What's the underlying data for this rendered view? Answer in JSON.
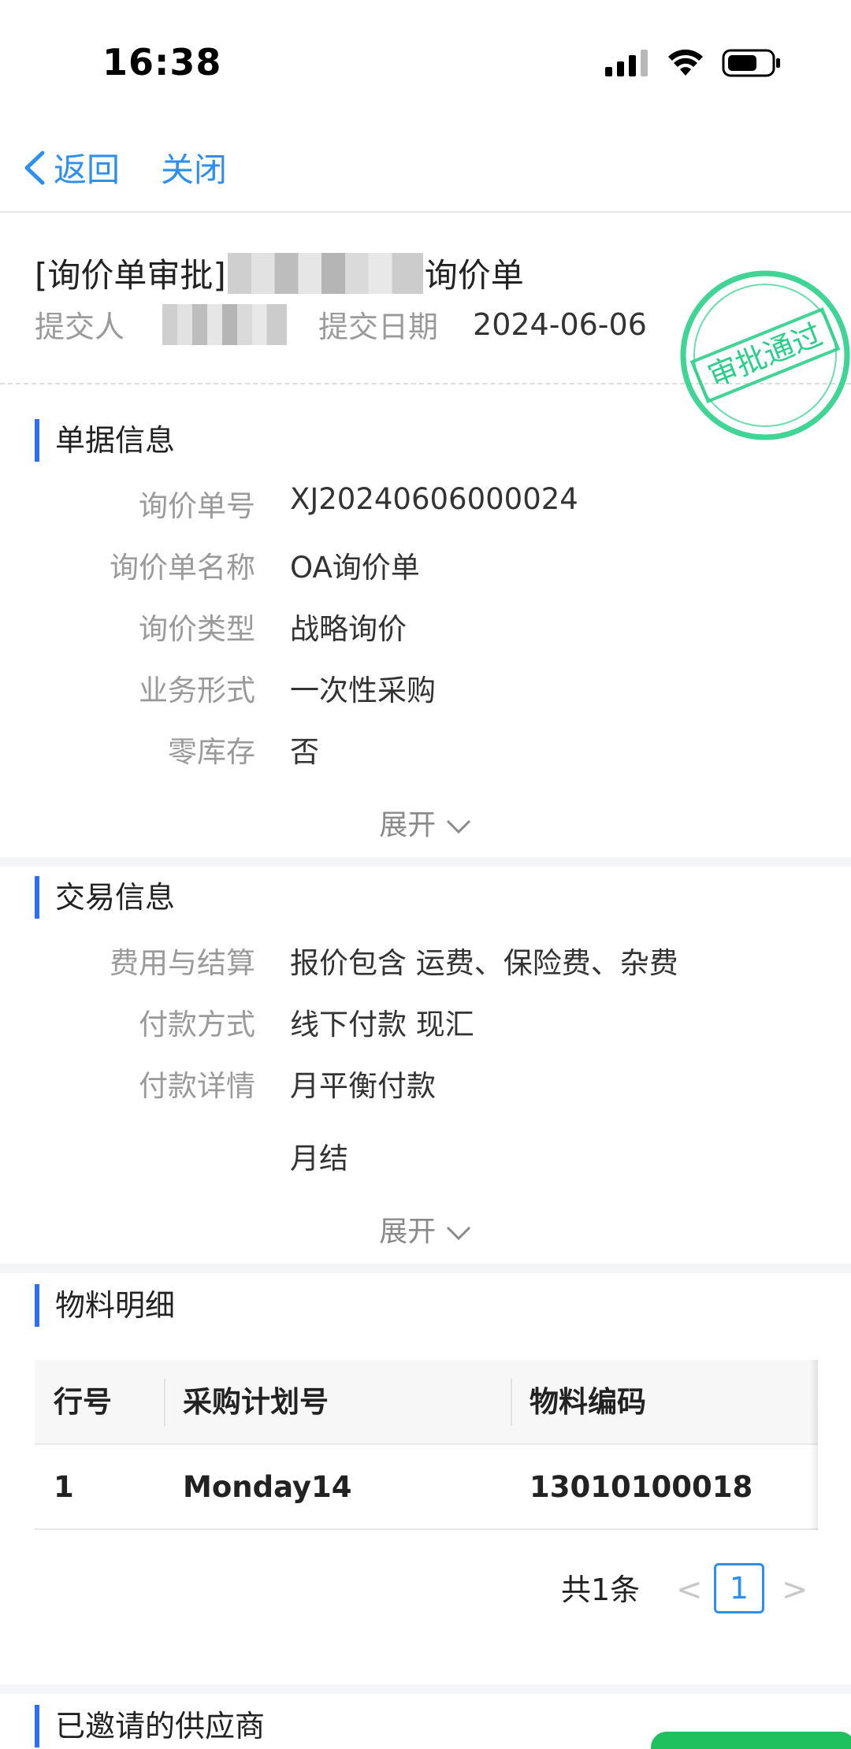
{
  "status_bar": {
    "time": "16:38"
  },
  "nav": {
    "back_label": "返回",
    "close_label": "关闭"
  },
  "header": {
    "title_prefix": "[询价单审批]",
    "title_suffix": "询价单",
    "submitter_label": "提交人",
    "submit_date_label": "提交日期",
    "submit_date": "2024-06-06",
    "stamp_text": "审批通过"
  },
  "doc_info": {
    "title": "单据信息",
    "fields": [
      {
        "label": "询价单号",
        "value": "XJ20240606000024"
      },
      {
        "label": "询价单名称",
        "value": "OA询价单"
      },
      {
        "label": "询价类型",
        "value": "战略询价"
      },
      {
        "label": "业务形式",
        "value": "一次性采购"
      },
      {
        "label": "零库存",
        "value": "否"
      }
    ],
    "expand_label": "展开"
  },
  "trade_info": {
    "title": "交易信息",
    "fields": [
      {
        "label": "费用与结算",
        "value": "报价包含 运费、保险费、杂费"
      },
      {
        "label": "付款方式",
        "value": "线下付款 现汇"
      },
      {
        "label": "付款详情",
        "value": "月平衡付款"
      }
    ],
    "payment_note": "月结",
    "expand_label": "展开"
  },
  "material": {
    "title": "物料明细",
    "columns": [
      "行号",
      "采购计划号",
      "物料编码"
    ],
    "rows": [
      [
        "1",
        "Monday14",
        "13010100018"
      ]
    ],
    "pager": {
      "total": "共1条",
      "current_page": "1",
      "prev": "<",
      "next": ">"
    }
  },
  "suppliers": {
    "title": "已邀请的供应商"
  },
  "colors": {
    "accent": "#2f8ff0",
    "section_bar": "#2f6ef2",
    "stamp": "#2bcf8a"
  }
}
